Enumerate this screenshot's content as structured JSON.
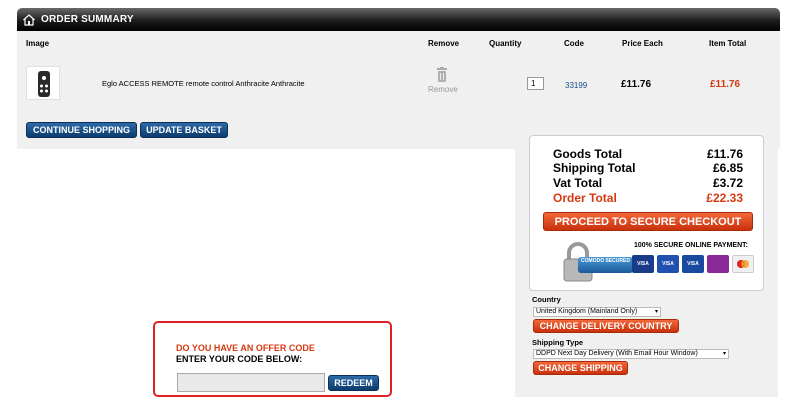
{
  "header": {
    "title": "ORDER SUMMARY",
    "icon": "home-icon"
  },
  "table": {
    "columns": [
      "Image",
      "Remove",
      "Quantity",
      "Code",
      "Price Each",
      "Item Total"
    ],
    "items": [
      {
        "name": "Eglo ACCESS REMOTE remote control Anthracite Anthracite",
        "remove_label": "Remove",
        "quantity": "1",
        "code": "33199",
        "price_each": "£11.76",
        "item_total": "£11.76"
      }
    ]
  },
  "actions": {
    "continue_label": "CONTINUE SHOPPING",
    "update_label": "UPDATE BASKET"
  },
  "totals": {
    "goods_label": "Goods Total",
    "goods_value": "£11.76",
    "shipping_label": "Shipping Total",
    "shipping_value": "£6.85",
    "vat_label": "Vat Total",
    "vat_value": "£3.72",
    "order_label": "Order Total",
    "order_value": "£22.33",
    "checkout_label": "PROCEED TO SECURE CHECKOUT",
    "badge_text": "COMODO SECURED",
    "secure_text": "100% SECURE ONLINE PAYMENT:",
    "cards": [
      "VISA",
      "VISA",
      "VISA",
      "",
      ""
    ]
  },
  "delivery": {
    "country_label": "Country",
    "country_value": "United Kingdom (Mainland Only)",
    "change_country_label": "CHANGE DELIVERY COUNTRY",
    "shipping_type_label": "Shipping Type",
    "shipping_type_value": "DDPD Next Day Delivery (With Email Hour Window)",
    "change_shipping_label": "CHANGE SHIPPING"
  },
  "offer": {
    "question": "DO YOU HAVE AN OFFER CODE",
    "instruction": "ENTER YOUR CODE BELOW:",
    "input_value": "",
    "redeem_label": "REDEEM"
  },
  "colors": {
    "accent_red": "#d63a12",
    "button_blue": "#0c3c6e"
  }
}
